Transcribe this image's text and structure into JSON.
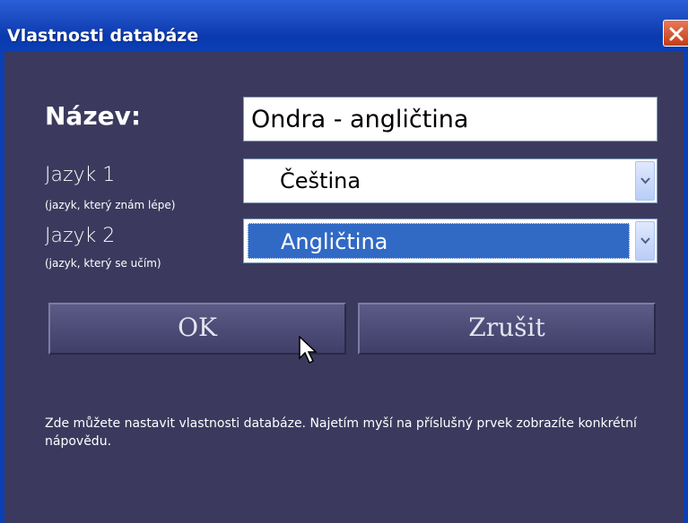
{
  "window": {
    "title": "Vlastnosti databáze"
  },
  "form": {
    "name_label": "Název:",
    "name_value": "Ondra - angličtina",
    "lang1_label": "Jazyk 1",
    "lang1_sub": "(jazyk, který znám lépe)",
    "lang1_value": "Čeština",
    "lang2_label": "Jazyk 2",
    "lang2_sub": "(jazyk, který se učím)",
    "lang2_value": "Angličtina"
  },
  "buttons": {
    "ok_label": "OK",
    "cancel_label": "Zrušit"
  },
  "help": {
    "text": "Zde můžete nastavit vlastnosti databáze. Najetím myší na příslušný prvek zobrazíte konkrétní nápovědu."
  },
  "icons": {
    "close": "close-icon",
    "dropdown": "chevron-down-icon",
    "cursor": "mouse-pointer-icon"
  },
  "colors": {
    "background": "#3b3a5e",
    "titlebar": "#0b3fb4",
    "selection": "#316ac5",
    "close": "#c33d15"
  }
}
